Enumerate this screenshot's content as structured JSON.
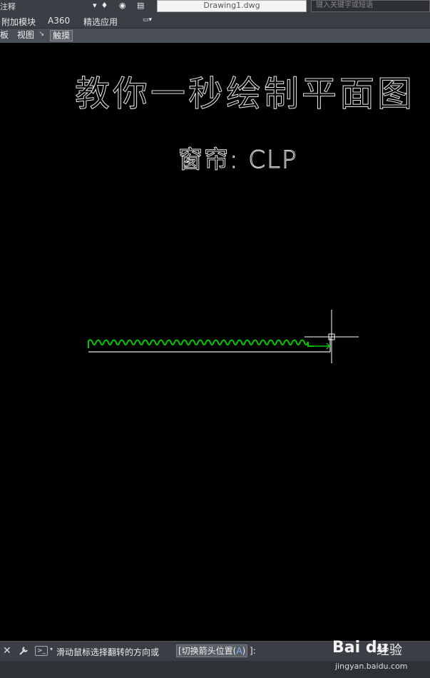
{
  "top_bar": {
    "workspace_label": "注释",
    "qat_icons": "▾♦ ◉ ▤",
    "document_title": "Drawing1.dwg",
    "search_placeholder": "键入关键字或短语"
  },
  "ribbon": {
    "tabs": [
      "附加模块",
      "A360",
      "精选应用"
    ],
    "extra_icon": "▭▾",
    "panel_row": {
      "board": "板",
      "view": "视图",
      "touch": "触摸"
    }
  },
  "canvas": {
    "title": "教你一秒绘制平面图",
    "subtitle": "窗帘: CLP",
    "background_color": "#000000",
    "text_color": "#e8e8e8",
    "curtain_color": "#00c800",
    "crosshair_color": "#ffffff"
  },
  "command_line": {
    "close_icon": "✕",
    "prompt": "滑动鼠标选择翻转的方向或",
    "option_prefix": "[切换箭头位置(",
    "option_key": "A",
    "option_suffix": ")",
    "prompt_end": "]:"
  },
  "watermark": {
    "logo": "Bai du",
    "suffix": "经验",
    "url": "jingyan.baidu.com"
  }
}
